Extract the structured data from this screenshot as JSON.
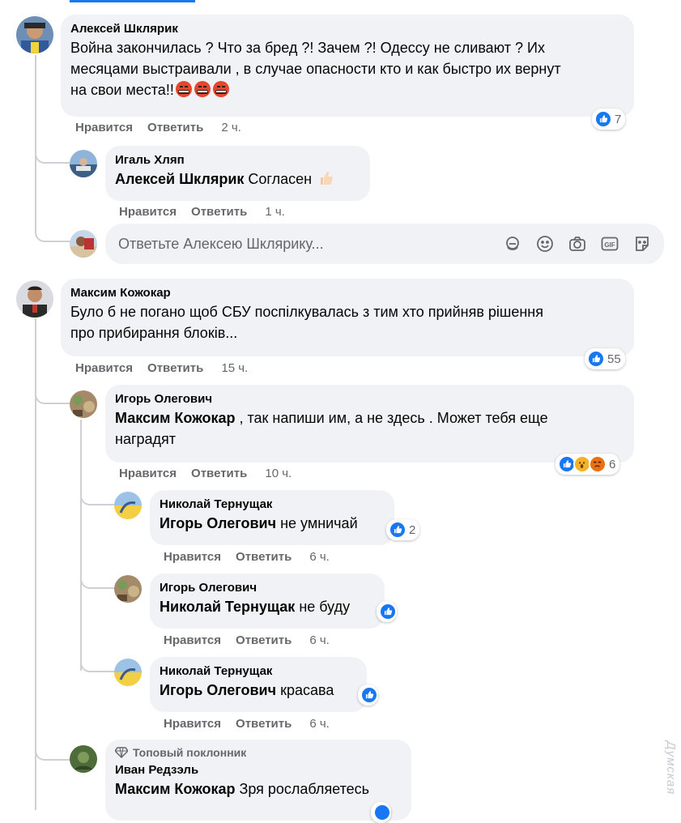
{
  "colors": {
    "accent": "#1877f2",
    "bubble": "#f0f2f5",
    "muted": "#65676b"
  },
  "actions": {
    "like": "Нравится",
    "reply": "Ответить"
  },
  "comments": [
    {
      "author": "Алексей Шклярик",
      "text_line1": "Война закончилась ? Что за бред ?! Зачем ?! Одессу не сливают ? Их",
      "text_line2": "месяцами выстраивали , в случае опасности кто и как быстро их вернут",
      "text_line3": "на свои места!!",
      "time": "2 ч.",
      "reactions": "7"
    },
    {
      "author": "Игаль Хляп",
      "mention": "Алексей Шклярик",
      "text": " Согласен",
      "time": "1 ч."
    },
    {
      "author": "Максим Кожокар",
      "text_line1": "Було б не погано щоб СБУ поспілкувалась з тим хто прийняв рішення",
      "text_line2": "про прибирання блоків...",
      "time": "15 ч.",
      "reactions": "55"
    },
    {
      "author": "Игорь Олегович",
      "mention": "Максим Кожокар",
      "text_line1": " , так напиши им, а не здесь . Может тебя еще",
      "text_line2": "наградят",
      "time": "10 ч.",
      "reactions": "6"
    },
    {
      "author": "Николай Тернущак",
      "mention": "Игорь Олегович",
      "text": " не умничай",
      "time": "6 ч.",
      "reactions": "2"
    },
    {
      "author": "Игорь Олегович",
      "mention": "Николай Тернущак",
      "text": " не буду",
      "time": "6 ч."
    },
    {
      "author": "Николай Тернущак",
      "mention": "Игорь Олегович",
      "text": " красава",
      "time": "6 ч."
    },
    {
      "badge": "Топовый поклонник",
      "author": "Иван Редзэль",
      "mention": "Максим Кожокар",
      "text": " Зря рослабляетесь"
    }
  ],
  "reply_box": {
    "placeholder": "Ответьте Алексею Шклярику..."
  },
  "watermark": "Думская"
}
